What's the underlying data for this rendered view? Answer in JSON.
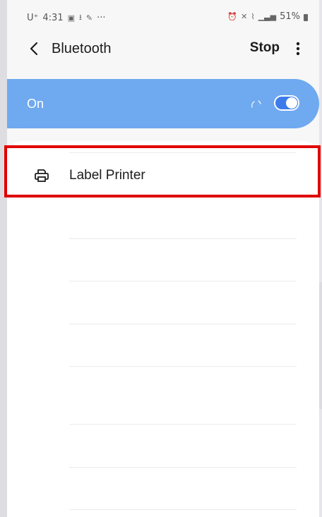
{
  "status_bar": {
    "carrier": "U⁺",
    "time": "4:31",
    "more_notifications": "···",
    "battery_percent": "51%"
  },
  "app_bar": {
    "title": "Bluetooth",
    "stop_label": "Stop"
  },
  "bluetooth_toggle": {
    "state_label": "On",
    "enabled": true
  },
  "devices": [
    {
      "name": "Label Printer",
      "icon": "printer-icon"
    }
  ],
  "colors": {
    "banner": "#6fa9f0",
    "toggle_on": "#3d7bea",
    "highlight": "#e00000",
    "background": "#f7f7f7"
  }
}
